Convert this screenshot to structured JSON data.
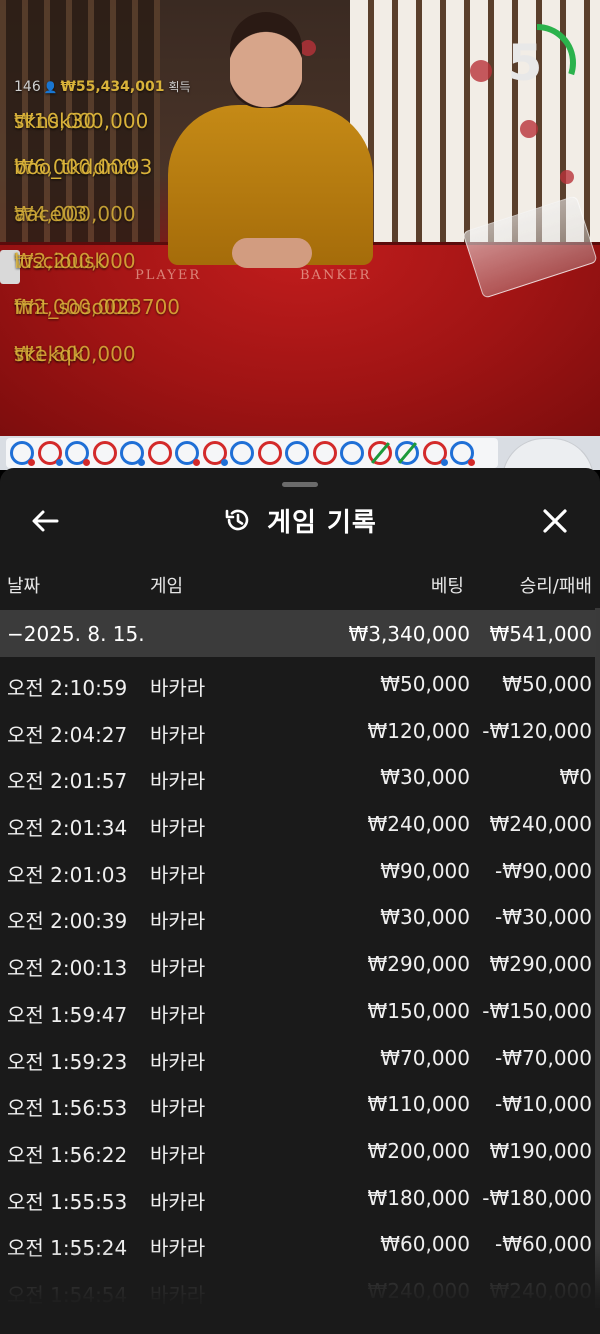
{
  "stream": {
    "timer_value": "5",
    "timer_progress": 0.3,
    "table_labels": {
      "player": "PLAYER",
      "banker": "BANKER"
    },
    "winners": {
      "count": "146",
      "total": "₩55,434,001",
      "suffix": "획득",
      "list": [
        {
          "amount": "₩10,000,000",
          "name": "sknsk30"
        },
        {
          "amount": "₩6,000,000",
          "name": "boo_tkddnr93"
        },
        {
          "amount": "₩4,000,000",
          "name": "aace03"
        },
        {
          "amount": "₩2,200,000",
          "name": "lusciousk"
        },
        {
          "amount": "₩2,000,000",
          "name": "fmt_soso023700"
        },
        {
          "amount": "₩1,800,000",
          "name": "skekqk"
        }
      ]
    },
    "road": [
      {
        "c": "blue",
        "dot": "red"
      },
      {
        "c": "red",
        "dot": "blue"
      },
      {
        "c": "blue",
        "dot": "red"
      },
      {
        "c": "red"
      },
      {
        "c": "blue",
        "dot": "blue"
      },
      {
        "c": "red"
      },
      {
        "c": "blue",
        "dot": "red"
      },
      {
        "c": "red",
        "dot": "blue"
      },
      {
        "c": "blue"
      },
      {
        "c": "red"
      },
      {
        "c": "blue"
      },
      {
        "c": "red"
      },
      {
        "c": "blue"
      },
      {
        "c": "red",
        "slash": true
      },
      {
        "c": "blue",
        "slash": true
      },
      {
        "c": "red",
        "dot": "blue"
      },
      {
        "c": "blue",
        "dot": "red"
      }
    ]
  },
  "panel": {
    "title": "게임 기록",
    "columns": {
      "date": "날짜",
      "game": "게임",
      "bet": "베팅",
      "winloss": "승리/패배"
    },
    "group": {
      "date": "−2025. 8. 15.",
      "bet": "₩3,340,000",
      "winloss": "₩541,000"
    },
    "rows": [
      {
        "time": "오전 2:10:59",
        "game": "바카라",
        "bet": "₩50,000",
        "winloss": "₩50,000"
      },
      {
        "time": "오전 2:04:27",
        "game": "바카라",
        "bet": "₩120,000",
        "winloss": "-₩120,000"
      },
      {
        "time": "오전 2:01:57",
        "game": "바카라",
        "bet": "₩30,000",
        "winloss": "₩0"
      },
      {
        "time": "오전 2:01:34",
        "game": "바카라",
        "bet": "₩240,000",
        "winloss": "₩240,000"
      },
      {
        "time": "오전 2:01:03",
        "game": "바카라",
        "bet": "₩90,000",
        "winloss": "-₩90,000"
      },
      {
        "time": "오전 2:00:39",
        "game": "바카라",
        "bet": "₩30,000",
        "winloss": "-₩30,000"
      },
      {
        "time": "오전 2:00:13",
        "game": "바카라",
        "bet": "₩290,000",
        "winloss": "₩290,000"
      },
      {
        "time": "오전 1:59:47",
        "game": "바카라",
        "bet": "₩150,000",
        "winloss": "-₩150,000"
      },
      {
        "time": "오전 1:59:23",
        "game": "바카라",
        "bet": "₩70,000",
        "winloss": "-₩70,000"
      },
      {
        "time": "오전 1:56:53",
        "game": "바카라",
        "bet": "₩110,000",
        "winloss": "-₩10,000"
      },
      {
        "time": "오전 1:56:22",
        "game": "바카라",
        "bet": "₩200,000",
        "winloss": "₩190,000"
      },
      {
        "time": "오전 1:55:53",
        "game": "바카라",
        "bet": "₩180,000",
        "winloss": "-₩180,000"
      },
      {
        "time": "오전 1:55:24",
        "game": "바카라",
        "bet": "₩60,000",
        "winloss": "-₩60,000"
      },
      {
        "time": "오전 1:54:54",
        "game": "바카라",
        "bet": "₩240,000",
        "winloss": "₩240,000"
      }
    ]
  },
  "colors": {
    "panel_bg": "#1a1a1a",
    "group_row_bg": "#3b3b3b",
    "winner_gold": "#d9b23a",
    "timer_green": "#2bb24c",
    "road_red": "#d32a2a",
    "road_blue": "#1f6fd6"
  }
}
